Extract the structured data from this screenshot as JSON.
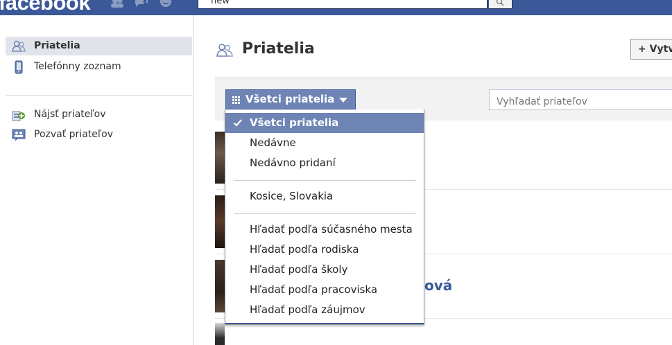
{
  "topbar": {
    "logo": "facebook",
    "search_value": "new",
    "icons": [
      "friend-requests-icon",
      "messages-icon",
      "notifications-icon"
    ]
  },
  "sidebar": {
    "items": [
      {
        "label": "Priatelia",
        "icon": "friends-icon",
        "selected": true
      },
      {
        "label": "Telefónny zoznam",
        "icon": "phone-icon",
        "selected": false
      },
      {
        "label": "Nájsť priateľov",
        "icon": "find-friends-icon",
        "selected": false
      },
      {
        "label": "Pozvať priateľov",
        "icon": "invite-friends-icon",
        "selected": false
      }
    ]
  },
  "main": {
    "title": "Priatelia",
    "title_icon": "friends-icon",
    "create_button": "+ Vytv",
    "filter_label": "Všetci priatelia",
    "search_placeholder": "Vyhľadať priateľov",
    "visible_name_fragment": "ová"
  },
  "dropdown": {
    "items": [
      {
        "label": "Všetci priatelia",
        "selected": true
      },
      {
        "label": "Nedávne"
      },
      {
        "label": "Nedávno pridaní"
      },
      {
        "label": "Kosice, Slovakia"
      },
      {
        "label": "Hľadať podľa súčasného mesta"
      },
      {
        "label": "Hľadať podľa rodiska"
      },
      {
        "label": "Hľadať podľa školy"
      },
      {
        "label": "Hľadať podľa pracoviska"
      },
      {
        "label": "Hľadať podľa záujmov"
      }
    ]
  },
  "colors": {
    "brand_blue": "#3b5998",
    "menu_selected": "#6d84b4",
    "link_blue": "#3b5998"
  }
}
